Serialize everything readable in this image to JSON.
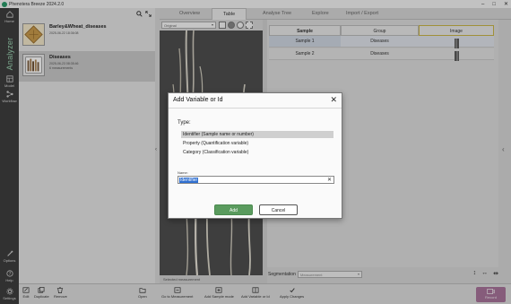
{
  "window": {
    "title": "Phenotera Breeze 2024.2.0",
    "controls": {
      "minimize": "–",
      "maximize": "□",
      "close": "✕"
    }
  },
  "rail": {
    "analyzer_label": "Analyzer",
    "items": [
      {
        "label": "Home",
        "icon": "home-icon"
      },
      {
        "label": "Model",
        "icon": "model-icon"
      },
      {
        "label": "Workflow",
        "icon": "workflow-icon"
      },
      {
        "label": "Options",
        "icon": "options-icon"
      },
      {
        "label": "Help",
        "icon": "help-icon"
      },
      {
        "label": "Settings",
        "icon": "settings-icon"
      }
    ]
  },
  "projects": [
    {
      "name": "Barley&Wheat_diseases",
      "meta1": "2025-06-22 18:36:08",
      "meta2": ""
    },
    {
      "name": "Diseases",
      "meta1": "2025-06-23 08:35:46",
      "meta2": "6 measurements"
    }
  ],
  "project_actions": [
    "Edit",
    "Duplicate",
    "Remove",
    "Open"
  ],
  "tabs": [
    "Overview",
    "Table",
    "Analyse Tree",
    "Explore",
    "Import / Export"
  ],
  "active_tab": "Table",
  "image_view": {
    "mode": "Original",
    "caption": "Selected measurement"
  },
  "table": {
    "columns": [
      "Sample",
      "Group",
      "Image"
    ],
    "rows": [
      {
        "sample": "Sample 1",
        "group": "Diseases"
      },
      {
        "sample": "Sample 2",
        "group": "Diseases"
      }
    ]
  },
  "segmentation": {
    "label": "Segmentation",
    "value": "Measurement"
  },
  "bottom_actions": [
    "Go to Measurement",
    "Add Sample mode",
    "Add Variable or Id",
    "Apply Changes"
  ],
  "record_label": "Record",
  "dialog": {
    "title": "Add Variable or Id",
    "type_label": "Type:",
    "options": [
      "Identifier (Sample name or number)",
      "Property (Quantification variable)",
      "Category (Classification variable)"
    ],
    "selected_option": 0,
    "name_label": "Name:",
    "name_value": "Identifier",
    "add_label": "Add",
    "cancel_label": "Cancel"
  },
  "colors": {
    "accent": "#5a9b5e",
    "rail": "#3e3e3e",
    "record": "#a8739a",
    "selection": "#2f6fd0"
  }
}
